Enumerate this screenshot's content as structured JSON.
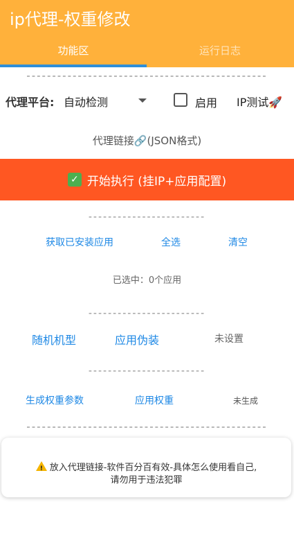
{
  "app": {
    "title": "ip代理-权重修改"
  },
  "tabs": [
    {
      "label": "功能区",
      "active": true
    },
    {
      "label": "运行日志",
      "active": false
    }
  ],
  "colors": {
    "appbar": "#FFB13B",
    "tab_indicator": "#2F8FD8",
    "run_button": "#FF5722",
    "link": "#1E88E5"
  },
  "dividers": {
    "long": "-----------------------------------------------",
    "short": "------------------------"
  },
  "proxy": {
    "platform_label": "代理平台:",
    "platform_value": "自动检测",
    "enable_label": "启用",
    "enable_checked": false,
    "ip_test_label": "IP测试🚀"
  },
  "link_section": {
    "label": "代理链接🔗(JSON格式)"
  },
  "run": {
    "label": "开始执行 (挂IP+应用配置)"
  },
  "apps": {
    "get_installed": "获取已安装应用",
    "select_all": "全选",
    "clear": "清空",
    "selected_status": "已选中：0个应用"
  },
  "device": {
    "random_model": "随机机型",
    "app_disguise": "应用伪装",
    "status": "未设置"
  },
  "weight": {
    "generate_params": "生成权重参数",
    "apply_weight": "应用权重",
    "status": "未生成"
  },
  "notice": {
    "line1": "放入代理链接-软件百分百有效-具体怎么使用看自己,",
    "line2": "请勿用于违法犯罪"
  }
}
